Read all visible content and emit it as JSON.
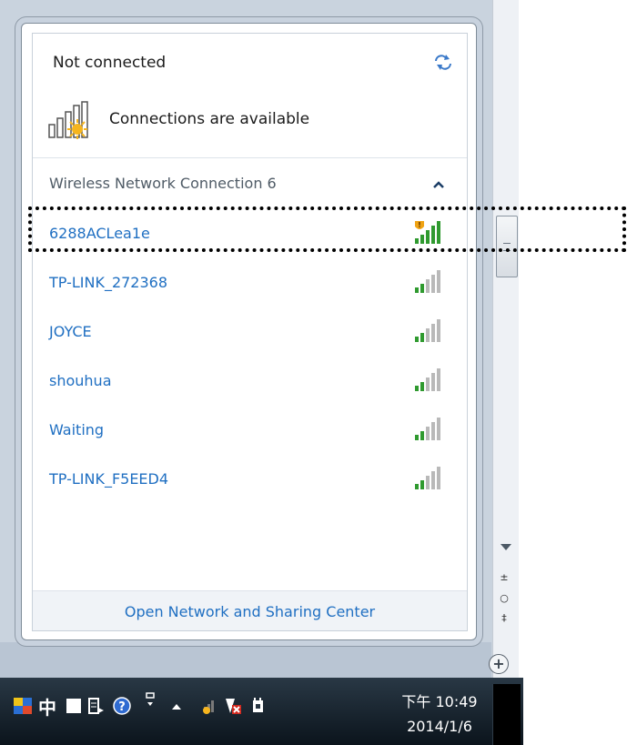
{
  "popup": {
    "status": "Not connected",
    "availability": "Connections are available",
    "section_title": "Wireless Network Connection 6",
    "networks": [
      {
        "ssid": "6288ACLea1e",
        "signal_bars": 5,
        "warning": true
      },
      {
        "ssid": "TP-LINK_272368",
        "signal_bars": 2,
        "warning": false
      },
      {
        "ssid": "JOYCE",
        "signal_bars": 2,
        "warning": false
      },
      {
        "ssid": "shouhua",
        "signal_bars": 2,
        "warning": false
      },
      {
        "ssid": "Waiting",
        "signal_bars": 2,
        "warning": false
      },
      {
        "ssid": "TP-LINK_F5EED4",
        "signal_bars": 2,
        "warning": false
      }
    ],
    "footer_link": "Open Network and Sharing Center"
  },
  "taskbar": {
    "clock_time": "下午 10:49",
    "clock_date": "2014/1/6",
    "ime_label": "中"
  },
  "colors": {
    "link": "#1f6fc2",
    "signal_active": "#2f9a2f",
    "signal_inactive": "#b9b9b9"
  }
}
